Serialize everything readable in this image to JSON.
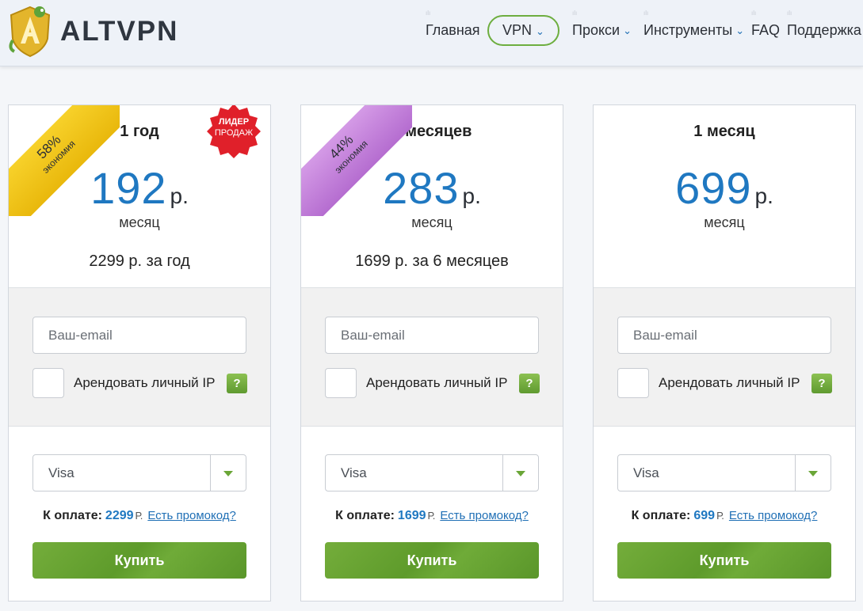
{
  "header": {
    "brand": "ALTVPN",
    "nav": {
      "home": "Главная",
      "vpn": "VPN",
      "proxy": "Прокси",
      "tools": "Инструменты",
      "faq": "FAQ",
      "support": "Поддержка"
    },
    "chevron_icon": "chevron-down-icon"
  },
  "colors": {
    "accent_blue": "#1f78c1",
    "accent_green": "#6aa637",
    "ribbon_gold": "#f0c41a",
    "ribbon_violet": "#c684dd",
    "badge_red": "#e0202a"
  },
  "plans": [
    {
      "ribbon": {
        "percent": "58%",
        "label": "экономия"
      },
      "badge": {
        "line1": "ЛИДЕР",
        "line2": "ПРОДАЖ"
      },
      "period": "1 год",
      "price": "192",
      "currency": "р.",
      "per": "месяц",
      "total": "2299 р. за год",
      "email_placeholder": "Ваш-email",
      "ip_label": "Арендовать личный IP",
      "help": "?",
      "payment_method": "Visa",
      "pay_label": "К оплате:",
      "pay_amount": "2299",
      "pay_currency": "Р.",
      "promo": "Есть промокод?",
      "buy": "Купить"
    },
    {
      "ribbon": {
        "percent": "44%",
        "label": "экономия"
      },
      "period": "6 месяцев",
      "price": "283",
      "currency": "р.",
      "per": "месяц",
      "total": "1699 р. за 6 месяцев",
      "email_placeholder": "Ваш-email",
      "ip_label": "Арендовать личный IP",
      "help": "?",
      "payment_method": "Visa",
      "pay_label": "К оплате:",
      "pay_amount": "1699",
      "pay_currency": "Р.",
      "promo": "Есть промокод?",
      "buy": "Купить"
    },
    {
      "period": "1 месяц",
      "price": "699",
      "currency": "р.",
      "per": "месяц",
      "total": "",
      "email_placeholder": "Ваш-email",
      "ip_label": "Арендовать личный IP",
      "help": "?",
      "payment_method": "Visa",
      "pay_label": "К оплате:",
      "pay_amount": "699",
      "pay_currency": "Р.",
      "promo": "Есть промокод?",
      "buy": "Купить"
    }
  ]
}
